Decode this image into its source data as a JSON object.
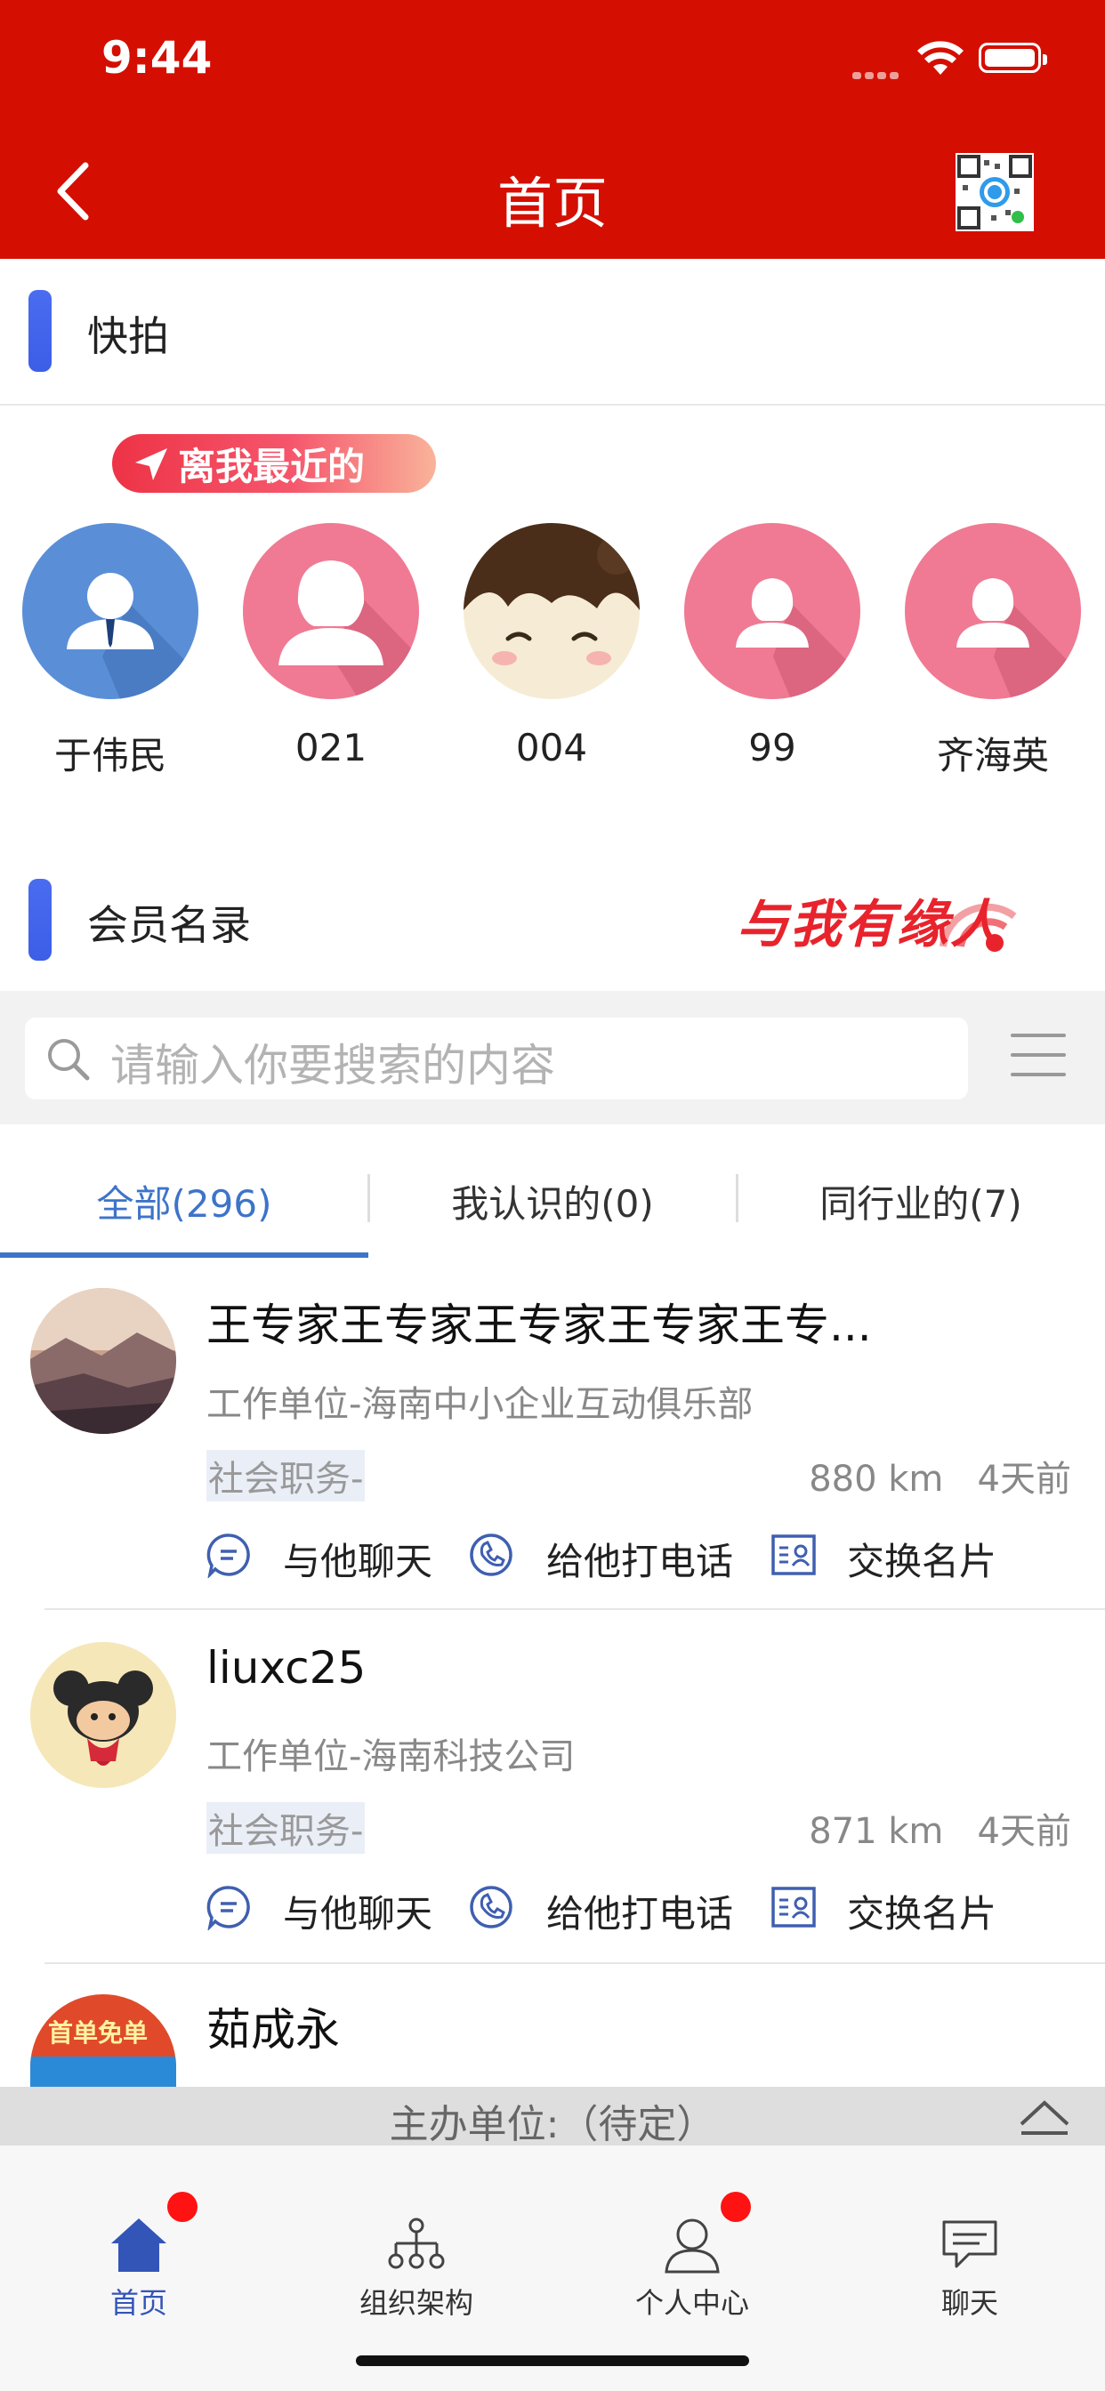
{
  "status": {
    "time": "9:44"
  },
  "nav": {
    "title": "首页"
  },
  "sections": {
    "quick_shot": "快拍",
    "members": "会员名录"
  },
  "nearby": {
    "badge": "离我最近的",
    "people": [
      {
        "name": "于伟民",
        "avatar": "male-avatar-icon"
      },
      {
        "name": "021",
        "avatar": "female-avatar-icon"
      },
      {
        "name": "004",
        "avatar": "cartoon-face-avatar"
      },
      {
        "name": "99",
        "avatar": "female-avatar-icon"
      },
      {
        "name": "齐海英",
        "avatar": "female-avatar-icon"
      }
    ]
  },
  "brand": {
    "text": "与我有缘人"
  },
  "search": {
    "placeholder": "请输入你要搜索的内容"
  },
  "tabs": [
    {
      "label": "全部(296)",
      "active": true
    },
    {
      "label": "我认识的(0)",
      "active": false
    },
    {
      "label": "同行业的(7)",
      "active": false
    }
  ],
  "actions": {
    "chat": "与他聊天",
    "call": "给他打电话",
    "card": "交换名片"
  },
  "members": [
    {
      "name": "王专家王专家王专家王专家王专...",
      "unit": "工作单位-海南中小企业互动俱乐部",
      "role": "社会职务-",
      "distance": "880 km",
      "time": "4天前"
    },
    {
      "name": "liuxc25",
      "unit": "工作单位-海南科技公司",
      "role": "社会职务-",
      "distance": "871 km",
      "time": "4天前"
    },
    {
      "name": "茹成永"
    }
  ],
  "third_avatar_text": {
    "line1": "首单免单"
  },
  "host": {
    "text": "主办单位:（待定）"
  },
  "tabbar": [
    {
      "label": "首页",
      "icon": "home-icon",
      "active": true,
      "badge": true
    },
    {
      "label": "组织架构",
      "icon": "org-chart-icon",
      "active": false,
      "badge": false
    },
    {
      "label": "个人中心",
      "icon": "person-icon",
      "active": false,
      "badge": true
    },
    {
      "label": "聊天",
      "icon": "chat-bubble-icon",
      "active": false,
      "badge": false
    }
  ],
  "colors": {
    "nav_red": "#d40f02",
    "accent_blue": "#3d74c9",
    "badge_red": "#ff1212"
  }
}
